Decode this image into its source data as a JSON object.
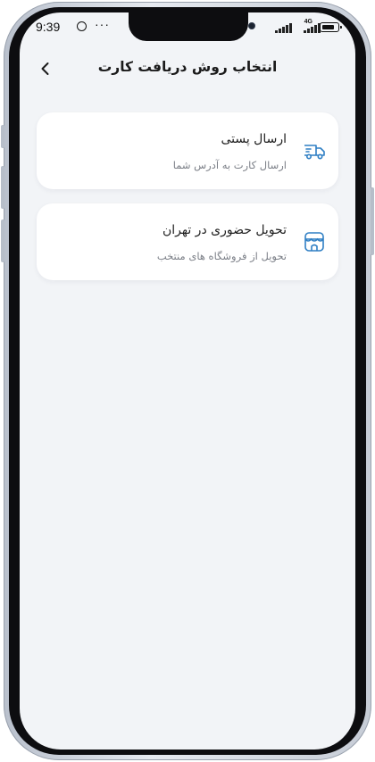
{
  "status_bar": {
    "time": "9:39",
    "dots": "···",
    "network": "4G"
  },
  "header": {
    "back_icon": "chevron-left-icon",
    "title": "انتخاب روش دریافت کارت"
  },
  "options": [
    {
      "title": "ارسال پستی",
      "subtitle": "ارسال کارت به آدرس شما",
      "icon": "truck-icon"
    },
    {
      "title": "تحویل حضوری در تهران",
      "subtitle": "تحویل از فروشگاه های منتخب",
      "icon": "store-icon"
    }
  ],
  "colors": {
    "screen_background": "#f2f4f7",
    "card_background": "#ffffff",
    "icon_accent": "#2f7fc4",
    "subtitle_text": "#7b7f87"
  }
}
